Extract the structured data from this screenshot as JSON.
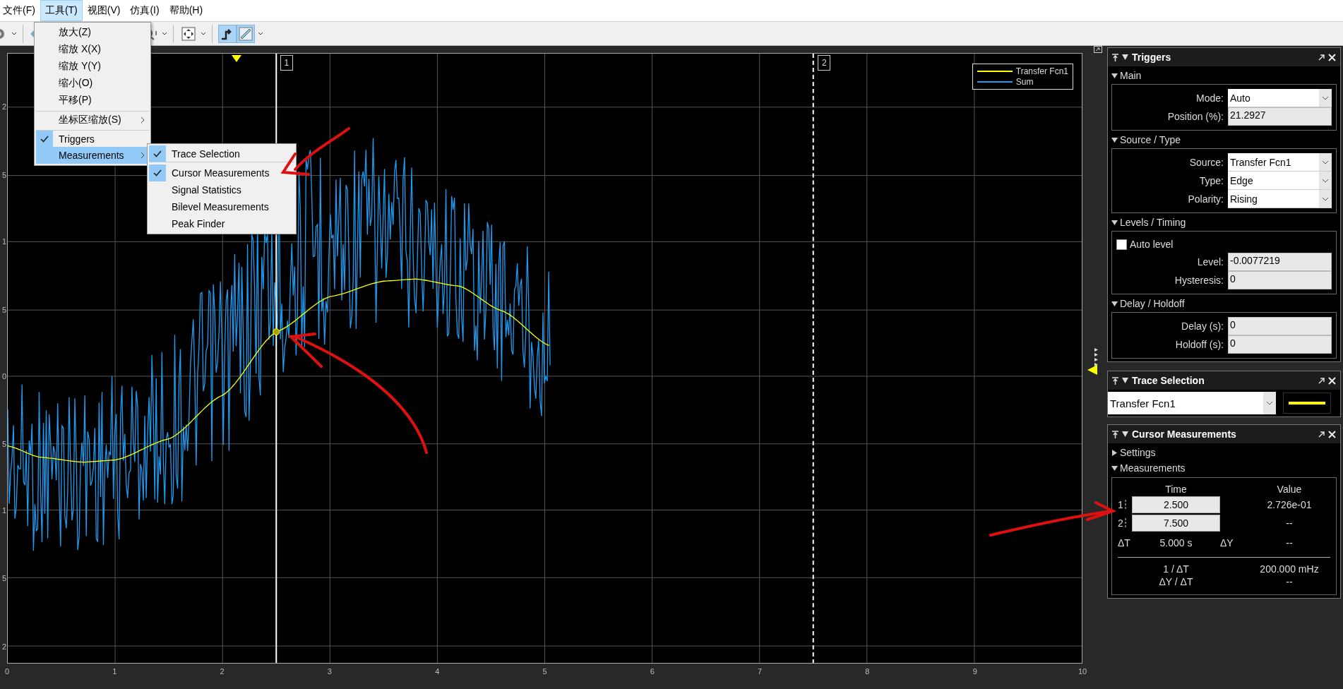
{
  "menu_bar": [
    {
      "label": "文件(F)",
      "selected": false
    },
    {
      "label": "工具(T)",
      "selected": true
    },
    {
      "label": "视图(V)",
      "selected": false
    },
    {
      "label": "仿真(I)",
      "selected": false
    },
    {
      "label": "帮助(H)",
      "selected": false
    }
  ],
  "tools_menu": [
    {
      "label": "放大(Z)",
      "checked": false,
      "submenu": false,
      "highlighted": false,
      "separator_before": false
    },
    {
      "label": "缩放 X(X)",
      "checked": false,
      "submenu": false,
      "highlighted": false,
      "separator_before": false
    },
    {
      "label": "缩放 Y(Y)",
      "checked": false,
      "submenu": false,
      "highlighted": false,
      "separator_before": false
    },
    {
      "label": "缩小(O)",
      "checked": false,
      "submenu": false,
      "highlighted": false,
      "separator_before": false
    },
    {
      "label": "平移(P)",
      "checked": false,
      "submenu": false,
      "highlighted": false,
      "separator_before": false
    },
    {
      "label": "坐标区缩放(S)",
      "checked": false,
      "submenu": true,
      "highlighted": false,
      "separator_before": true
    },
    {
      "label": "Triggers",
      "checked": true,
      "submenu": false,
      "highlighted": false,
      "separator_before": true
    },
    {
      "label": "Measurements",
      "checked": false,
      "submenu": true,
      "highlighted": true,
      "separator_before": false
    }
  ],
  "measurements_submenu": [
    {
      "label": "Trace Selection",
      "checked": true,
      "separator_after": true
    },
    {
      "label": "Cursor Measurements",
      "checked": true,
      "separator_after": false
    },
    {
      "label": "Signal Statistics",
      "checked": false,
      "separator_after": false
    },
    {
      "label": "Bilevel Measurements",
      "checked": false,
      "separator_after": false
    },
    {
      "label": "Peak Finder",
      "checked": false,
      "separator_after": false
    }
  ],
  "plot": {
    "y_tick_labels": [
      "2",
      "5",
      "1",
      "5",
      "0",
      "5",
      "1",
      "5",
      "2"
    ],
    "x_tick_labels": [
      "0",
      "1",
      "2",
      "3",
      "4",
      "5",
      "6",
      "7",
      "8",
      "9",
      "10"
    ],
    "cursors": [
      {
        "label": "1"
      },
      {
        "label": "2"
      }
    ],
    "legend": [
      {
        "name": "Transfer Fcn1",
        "color": "#ffff00"
      },
      {
        "name": "Sum",
        "color": "#1e9bf0"
      }
    ]
  },
  "triggers": {
    "title": "Triggers",
    "sections": [
      {
        "title": "Main",
        "expanded": true,
        "rows": [
          {
            "kind": "dropdown",
            "label": "Mode:",
            "value": "Auto"
          },
          {
            "kind": "field",
            "label": "Position (%):",
            "value": "21.2927"
          }
        ]
      },
      {
        "title": "Source / Type",
        "expanded": true,
        "rows": [
          {
            "kind": "dropdown",
            "label": "Source:",
            "value": "Transfer Fcn1"
          },
          {
            "kind": "dropdown",
            "label": "Type:",
            "value": "Edge"
          },
          {
            "kind": "dropdown",
            "label": "Polarity:",
            "value": "Rising"
          }
        ]
      },
      {
        "title": "Levels / Timing",
        "expanded": true,
        "rows": [
          {
            "kind": "checkbox",
            "label": "Auto level",
            "checked": false
          },
          {
            "kind": "field",
            "label": "Level:",
            "value": "-0.0077219"
          },
          {
            "kind": "field",
            "label": "Hysteresis:",
            "value": "0"
          }
        ]
      },
      {
        "title": "Delay / Holdoff",
        "expanded": true,
        "rows": [
          {
            "kind": "field",
            "label": "Delay (s):",
            "value": "0"
          },
          {
            "kind": "field",
            "label": "Holdoff (s):",
            "value": "0"
          }
        ]
      }
    ]
  },
  "trace_selection": {
    "title": "Trace Selection",
    "value": "Transfer Fcn1",
    "color": "#ffff00"
  },
  "cursor_measurements": {
    "title": "Cursor Measurements",
    "sections": [
      {
        "title": "Settings",
        "expanded": false
      },
      {
        "title": "Measurements",
        "expanded": true
      }
    ],
    "headers": [
      "Time",
      "Value"
    ],
    "cursors": [
      {
        "label": "1",
        "time": "2.500",
        "value": "2.726e-01"
      },
      {
        "label": "2",
        "time": "7.500",
        "value": "--"
      }
    ],
    "delta_t_label": "ΔT",
    "delta_t": "5.000 s",
    "delta_y_label": "ΔY",
    "delta_y": "--",
    "inverse_label": "1 / ΔT",
    "inverse": "200.000 mHz",
    "slope_label": "ΔY / ΔT",
    "slope": "--"
  }
}
